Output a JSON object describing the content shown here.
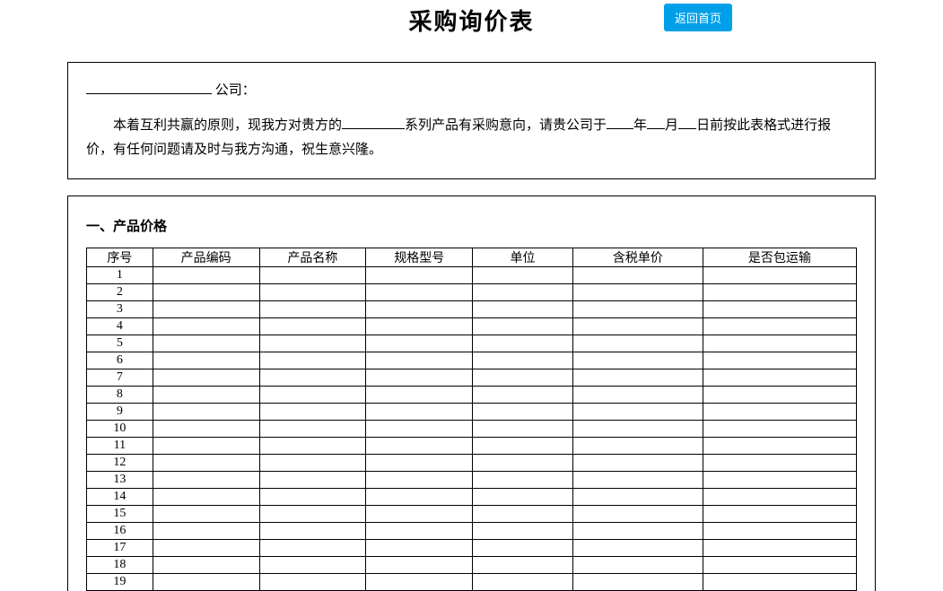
{
  "title": "采购询价表",
  "back_button": "返回首页",
  "intro": {
    "company_suffix": "公司：",
    "body_part1": "本着互利共赢的原则，现我方对贵方的",
    "body_part2": "系列产品有采购意向，请贵公司于",
    "body_year": "年",
    "body_month": "月",
    "body_day": "日前按此表格式进行报价，有任何问题请及时与我方沟通，祝生意兴隆。"
  },
  "section1": {
    "title": "一、产品价格",
    "headers": {
      "seq": "序号",
      "code": "产品编码",
      "name": "产品名称",
      "spec": "规格型号",
      "unit": "单位",
      "price": "含税单价",
      "ship": "是否包运输"
    },
    "rows": [
      {
        "seq": "1"
      },
      {
        "seq": "2"
      },
      {
        "seq": "3"
      },
      {
        "seq": "4"
      },
      {
        "seq": "5"
      },
      {
        "seq": "6"
      },
      {
        "seq": "7"
      },
      {
        "seq": "8"
      },
      {
        "seq": "9"
      },
      {
        "seq": "10"
      },
      {
        "seq": "11"
      },
      {
        "seq": "12"
      },
      {
        "seq": "13"
      },
      {
        "seq": "14"
      },
      {
        "seq": "15"
      },
      {
        "seq": "16"
      },
      {
        "seq": "17"
      },
      {
        "seq": "18"
      },
      {
        "seq": "19"
      }
    ]
  }
}
